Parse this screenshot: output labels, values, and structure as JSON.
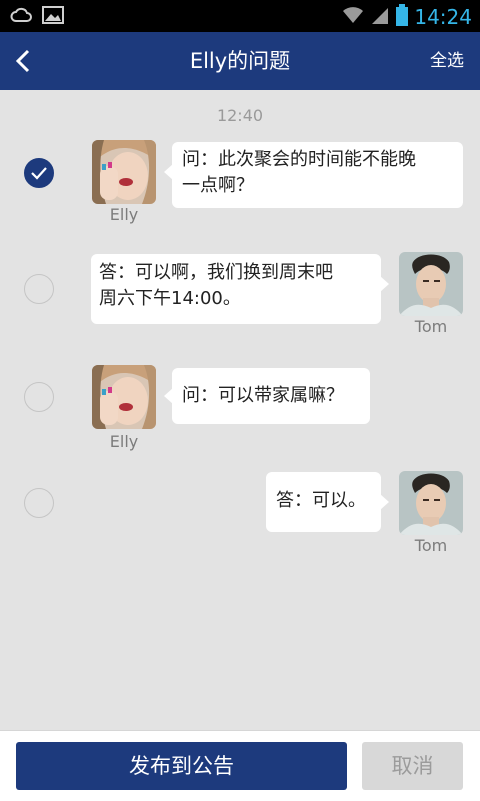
{
  "status_bar": {
    "time": "14:24",
    "icons": [
      "cloud-icon",
      "image-icon",
      "wifi-icon",
      "signal-icon",
      "battery-icon"
    ]
  },
  "header": {
    "title": "Elly的问题",
    "select_all": "全选",
    "back_icon": "back-arrow-icon"
  },
  "chat": {
    "timestamp": "12:40",
    "messages": [
      {
        "sender": "Elly",
        "side": "left",
        "selected": true,
        "text_line1": "问：此次聚会的时间能不能晚",
        "text_line2": "一点啊？"
      },
      {
        "sender": "Tom",
        "side": "right",
        "selected": false,
        "text_line1": "答：可以啊，我们换到周末吧",
        "text_line2": "周六下午14:00。"
      },
      {
        "sender": "Elly",
        "side": "left",
        "selected": false,
        "text_line1": "问：可以带家属嘛？"
      },
      {
        "sender": "Tom",
        "side": "right",
        "selected": false,
        "text_line1": "答：可以。"
      }
    ]
  },
  "bottom_bar": {
    "publish_label": "发布到公告",
    "cancel_label": "取消"
  },
  "colors": {
    "primary": "#1d3a7d",
    "background": "#e3e3e3",
    "time_accent": "#35b6e8"
  }
}
